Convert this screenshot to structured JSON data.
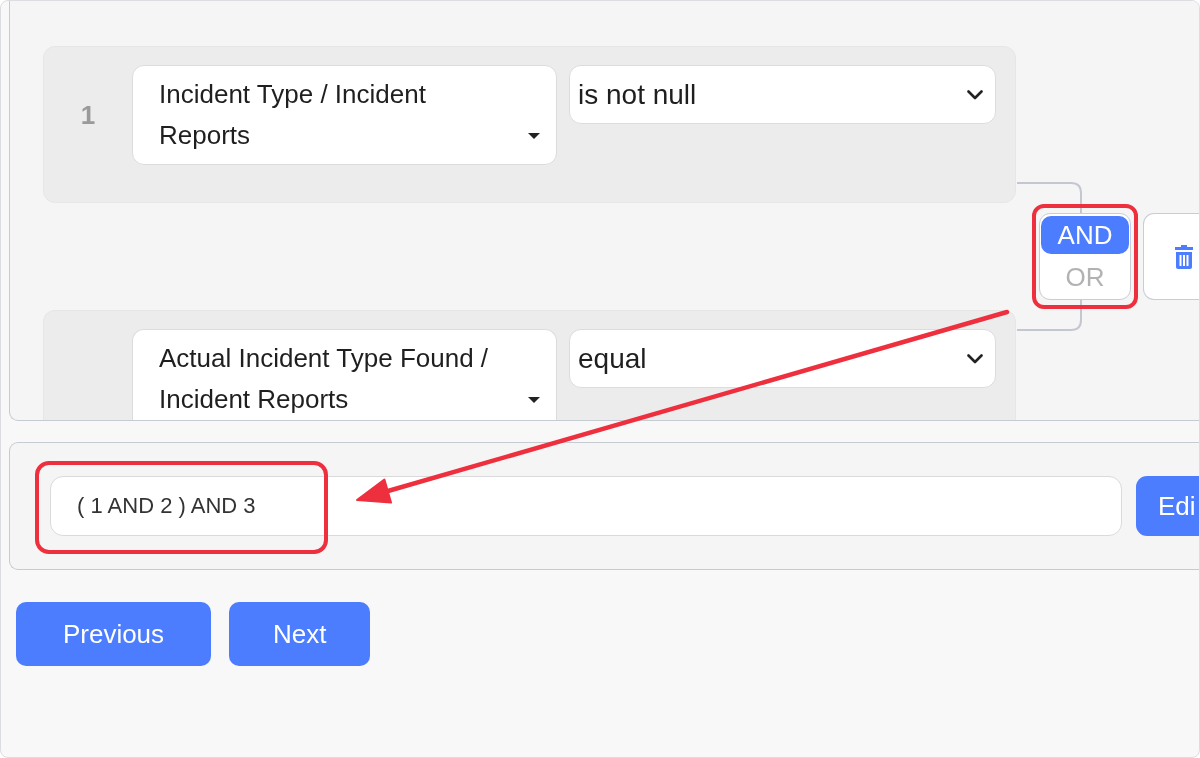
{
  "conditions": [
    {
      "number": "1",
      "field": "Incident Type / Incident Reports",
      "operator": "is not null"
    },
    {
      "field": "Actual Incident Type Found / Incident Reports",
      "operator": "equal"
    }
  ],
  "logic_toggle": {
    "options": [
      {
        "label": "AND",
        "selected": true
      },
      {
        "label": "OR",
        "selected": false
      }
    ],
    "highlighted": true
  },
  "expression": {
    "value": "( 1 AND 2 ) AND 3",
    "highlighted": true,
    "button": "Edi"
  },
  "callout_arrow": true,
  "buttons": [
    "Previous",
    "Next"
  ]
}
